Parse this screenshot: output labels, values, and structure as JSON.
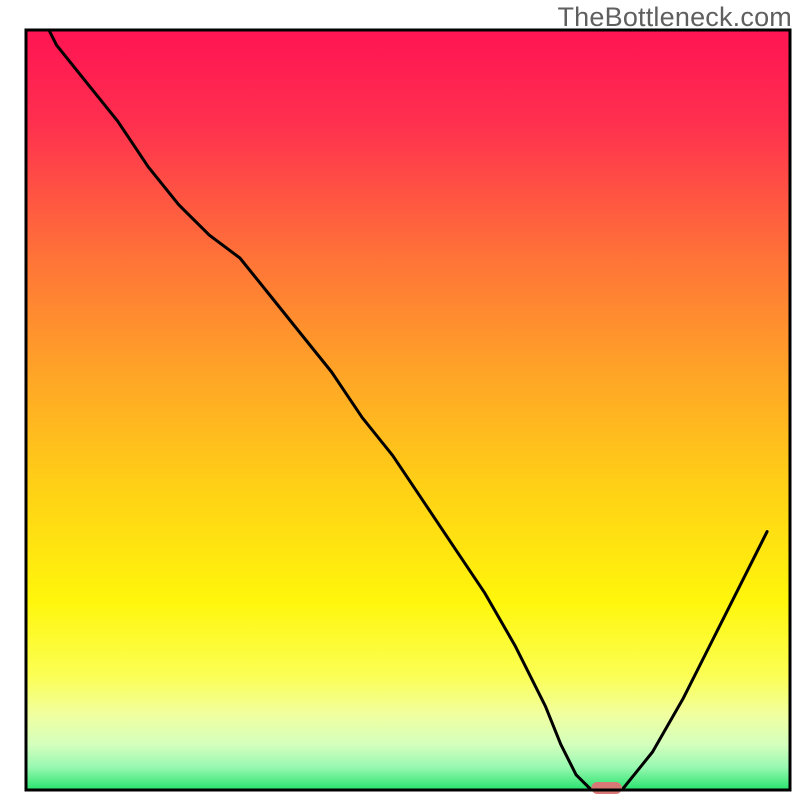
{
  "watermark": "TheBottleneck.com",
  "chart_data": {
    "type": "line",
    "title": "",
    "xlabel": "",
    "ylabel": "",
    "xlim": [
      0,
      100
    ],
    "ylim": [
      0,
      100
    ],
    "x": [
      3,
      4,
      8,
      12,
      16,
      20,
      24,
      28,
      32,
      36,
      40,
      44,
      48,
      52,
      56,
      60,
      64,
      68,
      70,
      72,
      74,
      76,
      78,
      82,
      86,
      90,
      94,
      97
    ],
    "values": [
      100,
      98,
      93,
      88,
      82,
      77,
      73,
      70,
      65,
      60,
      55,
      49,
      44,
      38,
      32,
      26,
      19,
      11,
      6,
      2,
      0,
      0,
      0,
      5,
      12,
      20,
      28,
      34
    ],
    "grid": false,
    "legend": false,
    "marker": {
      "x_range": [
        74,
        78
      ],
      "y": 0,
      "color": "#d87977"
    },
    "background_gradient": {
      "direction": "vertical",
      "stops": [
        {
          "pos": 0.0,
          "color": "#ff1453"
        },
        {
          "pos": 0.12,
          "color": "#ff2f4f"
        },
        {
          "pos": 0.3,
          "color": "#ff7338"
        },
        {
          "pos": 0.45,
          "color": "#ffa427"
        },
        {
          "pos": 0.6,
          "color": "#ffd016"
        },
        {
          "pos": 0.75,
          "color": "#fff60b"
        },
        {
          "pos": 0.85,
          "color": "#fbff54"
        },
        {
          "pos": 0.9,
          "color": "#f1ff9f"
        },
        {
          "pos": 0.94,
          "color": "#d4ffbd"
        },
        {
          "pos": 0.97,
          "color": "#98f8b1"
        },
        {
          "pos": 1.0,
          "color": "#27e36d"
        }
      ]
    },
    "frame_color": "#000000",
    "line_color": "#000000"
  }
}
